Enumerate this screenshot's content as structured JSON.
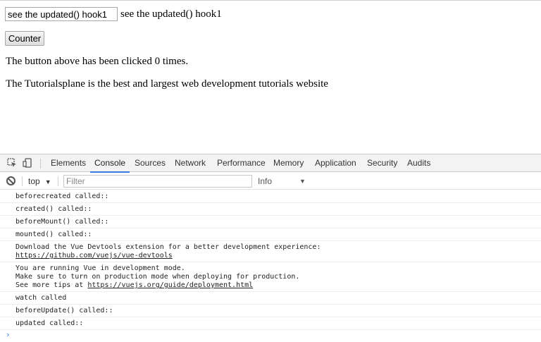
{
  "page": {
    "input_value": "see the updated() hook1",
    "echo_text": "see the updated() hook1",
    "counter_button": "Counter",
    "click_text": "The button above has been clicked 0 times.",
    "tagline": "The Tutorialsplane is the best and largest web development tutorials website"
  },
  "devtools": {
    "icons": [
      "inspect-element-icon",
      "device-toolbar-icon"
    ],
    "tabs": [
      "Elements",
      "Console",
      "Sources",
      "Network",
      "Performance",
      "Memory",
      "Application",
      "Security",
      "Audits"
    ],
    "active_tab": "Console",
    "toolbar": {
      "context": "top",
      "filter_placeholder": "Filter",
      "level": "Info"
    },
    "console": {
      "messages": [
        {
          "lines": [
            "beforecreated called::"
          ]
        },
        {
          "lines": [
            "created() called::"
          ]
        },
        {
          "lines": [
            "beforeMount() called::"
          ]
        },
        {
          "lines": [
            "mounted() called::"
          ]
        },
        {
          "lines": [
            "Download the Vue Devtools extension for a better development experience:"
          ],
          "link": "https://github.com/vuejs/vue-devtools"
        },
        {
          "lines": [
            "You are running Vue in development mode.",
            "Make sure to turn on production mode when deploying for production."
          ],
          "see_prefix": "See more tips at ",
          "link": "https://vuejs.org/guide/deployment.html"
        },
        {
          "lines": [
            "watch called"
          ]
        },
        {
          "lines": [
            "beforeUpdate() called::"
          ]
        },
        {
          "lines": [
            "updated called::"
          ]
        }
      ],
      "prompt": "›"
    }
  }
}
